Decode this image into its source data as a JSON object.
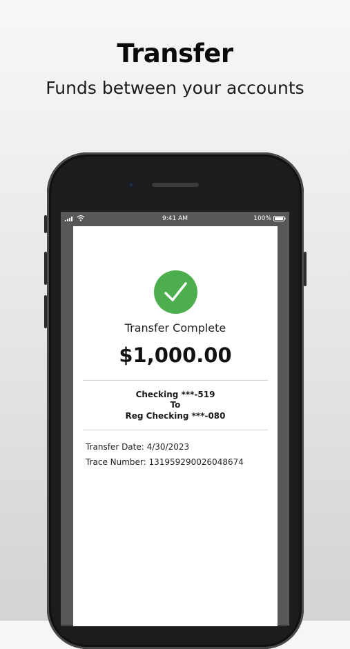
{
  "promo": {
    "title": "Transfer",
    "subtitle": "Funds between your accounts"
  },
  "status_bar": {
    "time": "9:41 AM",
    "battery_percent": "100%",
    "icons": [
      "cellular-signal-icon",
      "wifi-icon",
      "battery-icon"
    ]
  },
  "confirmation": {
    "icon": "checkmark-icon",
    "title": "Transfer Complete",
    "amount": "$1,000.00",
    "from_account": "Checking ***-519",
    "connector": "To",
    "to_account": "Reg Checking ***-080",
    "transfer_date_text": "Transfer Date: 4/30/2023",
    "trace_number_text": "Trace Number: 131959290026048674"
  },
  "colors": {
    "success_green": "#4cae4c",
    "status_bar_bg": "#58585a",
    "phone_body": "#1c1c1e"
  }
}
